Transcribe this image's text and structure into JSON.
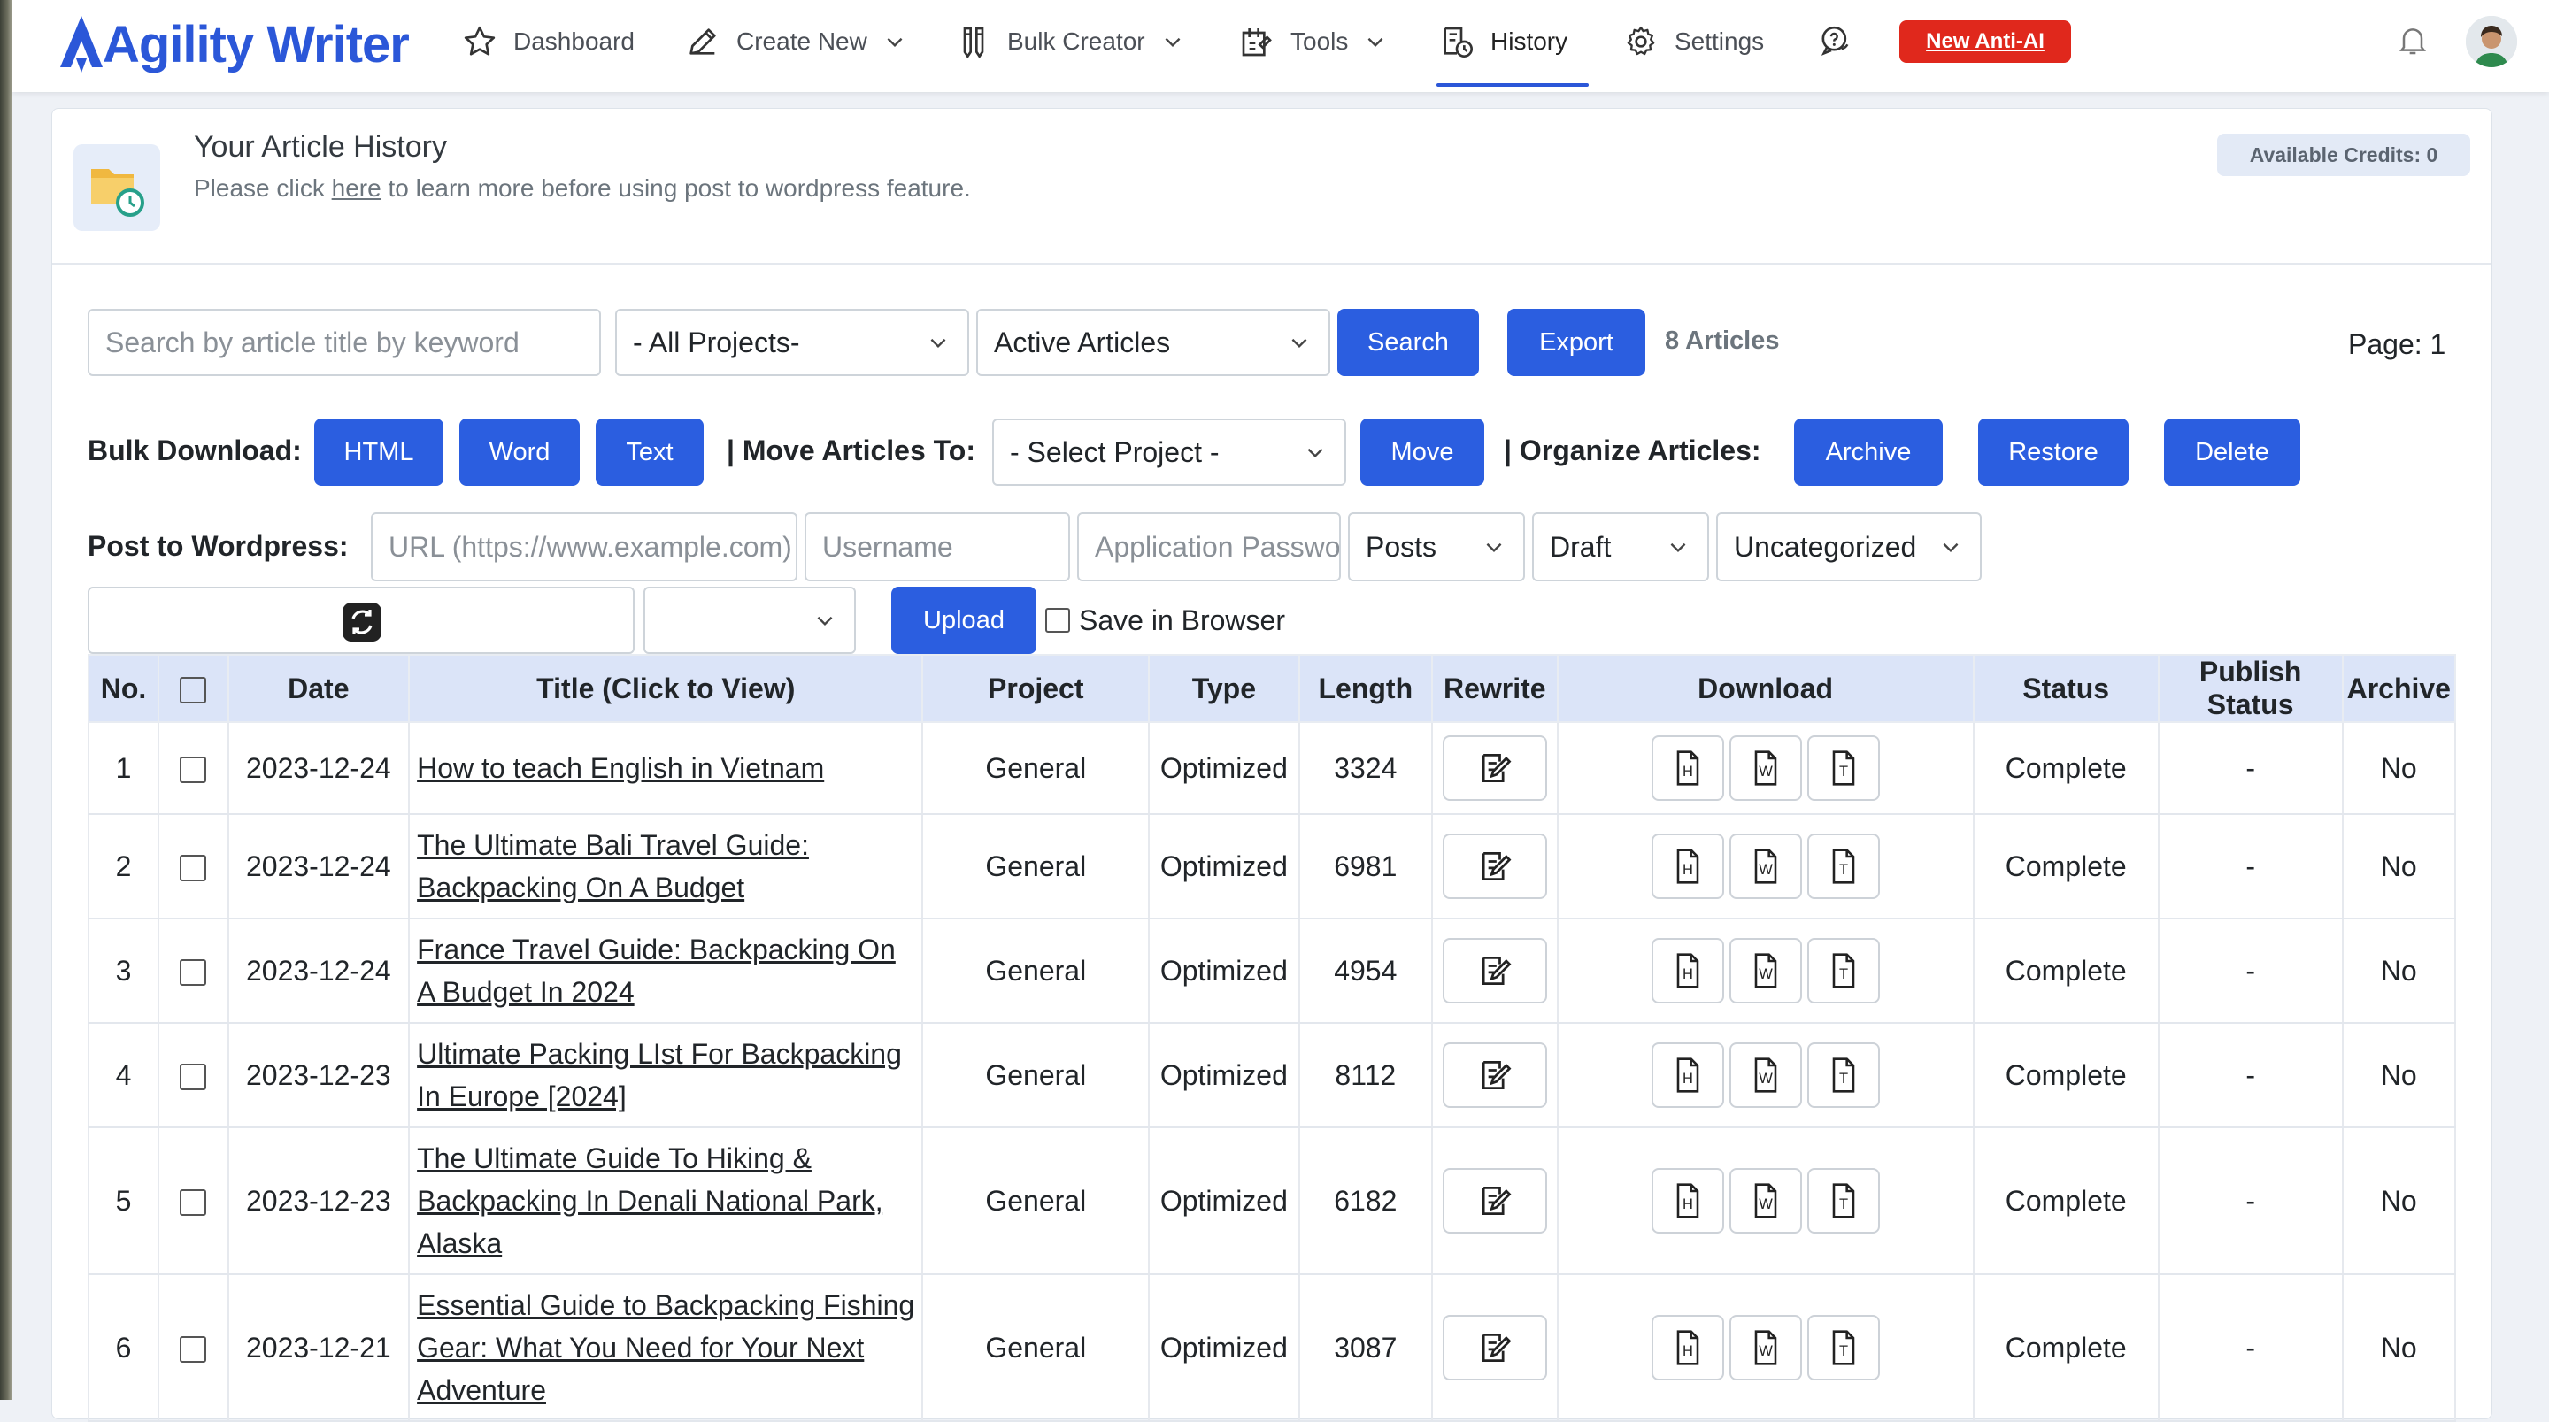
{
  "app": {
    "name": "Agility Writer"
  },
  "nav": {
    "items": [
      {
        "label": "Dashboard"
      },
      {
        "label": "Create New"
      },
      {
        "label": "Bulk Creator"
      },
      {
        "label": "Tools"
      },
      {
        "label": "History"
      },
      {
        "label": "Settings"
      }
    ],
    "active": "History",
    "promo_button": "New Anti-AI"
  },
  "header": {
    "title": "Your Article History",
    "sub_before": "Please click ",
    "sub_link": "here",
    "sub_after": " to learn more before using post to wordpress feature.",
    "credits": "Available Credits: 0"
  },
  "filters": {
    "search_placeholder": "Search by article title by keyword",
    "project_select": "- All Projects-",
    "status_select": "Active Articles",
    "search_button": "Search",
    "export_button": "Export",
    "article_count": "8 Articles",
    "page": "Page: 1"
  },
  "bulk": {
    "download_label": "Bulk Download:",
    "html": "HTML",
    "word": "Word",
    "text": "Text",
    "move_label": "| Move Articles To:",
    "project_select": "- Select Project -",
    "move_button": "Move",
    "organize_label": "| Organize Articles:",
    "archive": "Archive",
    "restore": "Restore",
    "delete": "Delete"
  },
  "wordpress": {
    "label": "Post to Wordpress:",
    "url_placeholder": "URL (https://www.example.com)",
    "user_placeholder": "Username",
    "pass_placeholder": "Application Password",
    "post_type": "Posts",
    "post_status": "Draft",
    "category": "Uncategorized",
    "upload_button": "Upload",
    "save_label": "Save in Browser"
  },
  "table": {
    "columns": [
      "No.",
      "Date",
      "Title (Click to View)",
      "Project",
      "Type",
      "Length",
      "Rewrite",
      "Download",
      "Status",
      "Publish Status",
      "Archive"
    ],
    "rows": [
      {
        "no": "1",
        "date": "2023-12-24",
        "title": "How to teach English in Vietnam",
        "project": "General",
        "type": "Optimized",
        "length": "3324",
        "status": "Complete",
        "publish": "-",
        "archive": "No"
      },
      {
        "no": "2",
        "date": "2023-12-24",
        "title": "The Ultimate Bali Travel Guide: Backpacking On A Budget",
        "project": "General",
        "type": "Optimized",
        "length": "6981",
        "status": "Complete",
        "publish": "-",
        "archive": "No"
      },
      {
        "no": "3",
        "date": "2023-12-24",
        "title": "France Travel Guide: Backpacking On A Budget In 2024",
        "project": "General",
        "type": "Optimized",
        "length": "4954",
        "status": "Complete",
        "publish": "-",
        "archive": "No"
      },
      {
        "no": "4",
        "date": "2023-12-23",
        "title": "Ultimate Packing LIst For Backpacking In Europe [2024]",
        "project": "General",
        "type": "Optimized",
        "length": "8112",
        "status": "Complete",
        "publish": "-",
        "archive": "No"
      },
      {
        "no": "5",
        "date": "2023-12-23",
        "title": "The Ultimate Guide To Hiking & Backpacking In Denali National Park, Alaska",
        "project": "General",
        "type": "Optimized",
        "length": "6182",
        "status": "Complete",
        "publish": "-",
        "archive": "No"
      },
      {
        "no": "6",
        "date": "2023-12-21",
        "title": "Essential Guide to Backpacking Fishing Gear: What You Need for Your Next Adventure",
        "project": "General",
        "type": "Optimized",
        "length": "3087",
        "status": "Complete",
        "publish": "-",
        "archive": "No"
      }
    ]
  },
  "colors": {
    "primary": "#2b5ee0",
    "promo": "#e0281c",
    "header_row": "#dbe4f8"
  }
}
